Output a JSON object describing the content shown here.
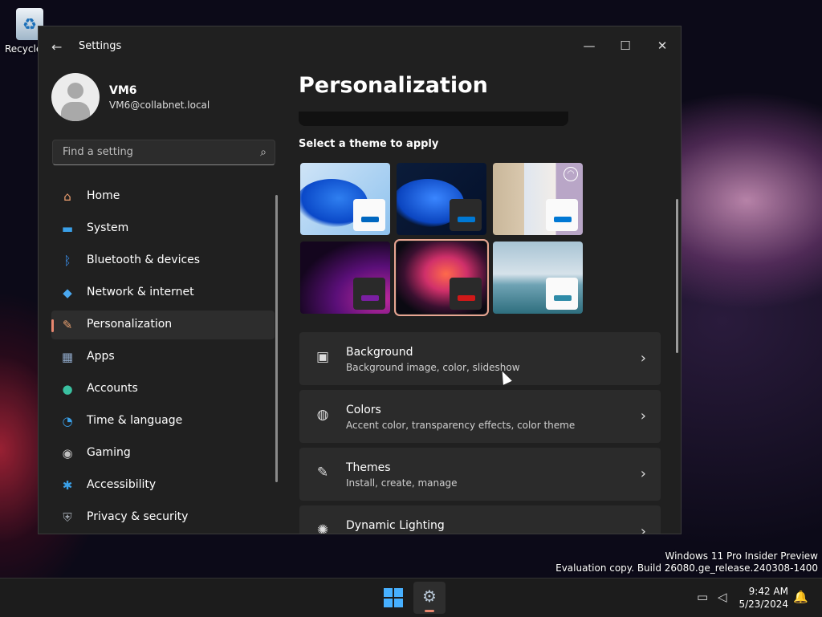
{
  "desktop": {
    "recycle_label": "Recycle"
  },
  "window": {
    "title": "Settings",
    "minimize": "—",
    "maximize": "☐",
    "close": "✕"
  },
  "profile": {
    "name": "VM6",
    "email": "VM6@collabnet.local"
  },
  "search": {
    "placeholder": "Find a setting"
  },
  "nav": {
    "items": [
      {
        "label": "Home",
        "icon": "home-icon",
        "glyph": "⌂",
        "color": "#f0a070"
      },
      {
        "label": "System",
        "icon": "monitor-icon",
        "glyph": "▬",
        "color": "#3aa0e8"
      },
      {
        "label": "Bluetooth & devices",
        "icon": "bluetooth-icon",
        "glyph": "ᛒ",
        "color": "#3a8ee8"
      },
      {
        "label": "Network & internet",
        "icon": "wifi-icon",
        "glyph": "◆",
        "color": "#4aa8f0"
      },
      {
        "label": "Personalization",
        "icon": "brush-icon",
        "glyph": "✎",
        "color": "#e8a070"
      },
      {
        "label": "Apps",
        "icon": "apps-icon",
        "glyph": "▦",
        "color": "#8fa8c8"
      },
      {
        "label": "Accounts",
        "icon": "person-icon",
        "glyph": "●",
        "color": "#3ac0a0"
      },
      {
        "label": "Time & language",
        "icon": "globe-clock-icon",
        "glyph": "◔",
        "color": "#3aa0e8"
      },
      {
        "label": "Gaming",
        "icon": "gamepad-icon",
        "glyph": "◉",
        "color": "#c0c0c0"
      },
      {
        "label": "Accessibility",
        "icon": "accessibility-icon",
        "glyph": "✱",
        "color": "#3aa0e8"
      },
      {
        "label": "Privacy & security",
        "icon": "shield-icon",
        "glyph": "⛨",
        "color": "#9aa0a8"
      }
    ],
    "selected": "Personalization"
  },
  "main": {
    "title": "Personalization",
    "themes_label": "Select a theme to apply",
    "themes": [
      {
        "name": "windows-light",
        "accent": "#0067c0",
        "selected": false
      },
      {
        "name": "windows-dark",
        "accent": "#0078d4",
        "selected": false
      },
      {
        "name": "windows-spotlight",
        "accent": "#0078d4",
        "selected": false
      },
      {
        "name": "glow",
        "accent": "#7a1fa2",
        "selected": false
      },
      {
        "name": "captured-motion",
        "accent": "#d01818",
        "selected": true
      },
      {
        "name": "flow",
        "accent": "#2e8ba8",
        "selected": false
      }
    ],
    "cards": [
      {
        "title": "Background",
        "subtitle": "Background image, color, slideshow",
        "icon": "image-icon",
        "glyph": "▣"
      },
      {
        "title": "Colors",
        "subtitle": "Accent color, transparency effects, color theme",
        "icon": "palette-icon",
        "glyph": "◍"
      },
      {
        "title": "Themes",
        "subtitle": "Install, create, manage",
        "icon": "pen-icon",
        "glyph": "✎"
      },
      {
        "title": "Dynamic Lighting",
        "subtitle": "",
        "icon": "lighting-icon",
        "glyph": "✺"
      }
    ]
  },
  "watermark": {
    "line1": "Windows 11 Pro Insider Preview",
    "line2": "Evaluation copy. Build 26080.ge_release.240308-1400"
  },
  "taskbar": {
    "time": "9:42 AM",
    "date": "5/23/2024"
  }
}
